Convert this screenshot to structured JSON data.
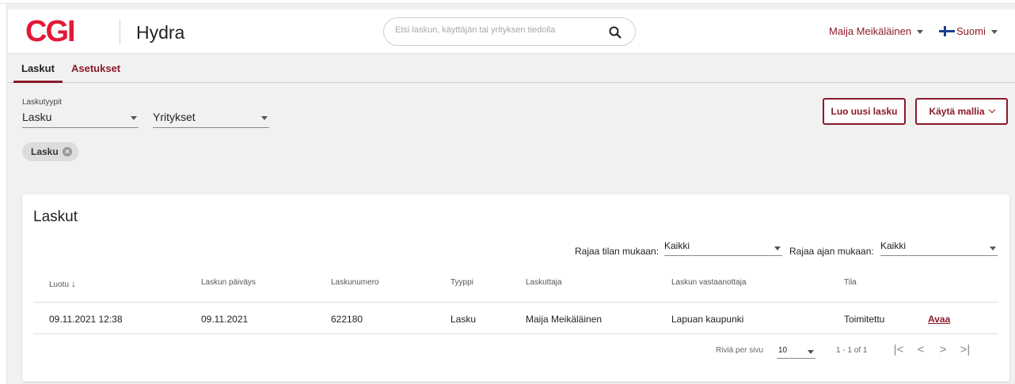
{
  "header": {
    "logo": "CGI",
    "app_name": "Hydra",
    "search_placeholder": "Etsi laskun, käyttäjän tai yrityksen tiedolla",
    "user_name": "Maija Meikäläinen",
    "language": "Suomi"
  },
  "tabs": [
    {
      "label": "Laskut",
      "active": true
    },
    {
      "label": "Asetukset",
      "active": false
    }
  ],
  "filters": {
    "type_label": "Laskutyypit",
    "type_value": "Lasku",
    "company_value": "Yritykset",
    "chip_label": "Lasku"
  },
  "actions": {
    "new_invoice": "Luo uusi lasku",
    "use_template": "Käytä mallia"
  },
  "card": {
    "title": "Laskut",
    "status_filter_label": "Rajaa tilan mukaan:",
    "status_filter_value": "Kaikki",
    "time_filter_label": "Rajaa ajan mukaan:",
    "time_filter_value": "Kaikki"
  },
  "table": {
    "columns": [
      "Luotu",
      "Laskun päiväys",
      "Laskunumero",
      "Tyyppi",
      "Laskuttaja",
      "Laskun vastaanottaja",
      "Tila"
    ],
    "sort_icon": "arrow-down-icon",
    "rows": [
      {
        "created": "09.11.2021 12:38",
        "date": "09.11.2021",
        "number": "622180",
        "type": "Lasku",
        "biller": "Maija Meikäläinen",
        "recipient": "Lapuan kaupunki",
        "status": "Toimitettu",
        "action": "Avaa"
      }
    ]
  },
  "pagination": {
    "rows_per_page_label": "Riviä per sivu",
    "rows_per_page_value": "10",
    "range": "1 - 1 of 1"
  },
  "colors": {
    "brand_red": "#e31937",
    "accent": "#8b1a2a"
  }
}
